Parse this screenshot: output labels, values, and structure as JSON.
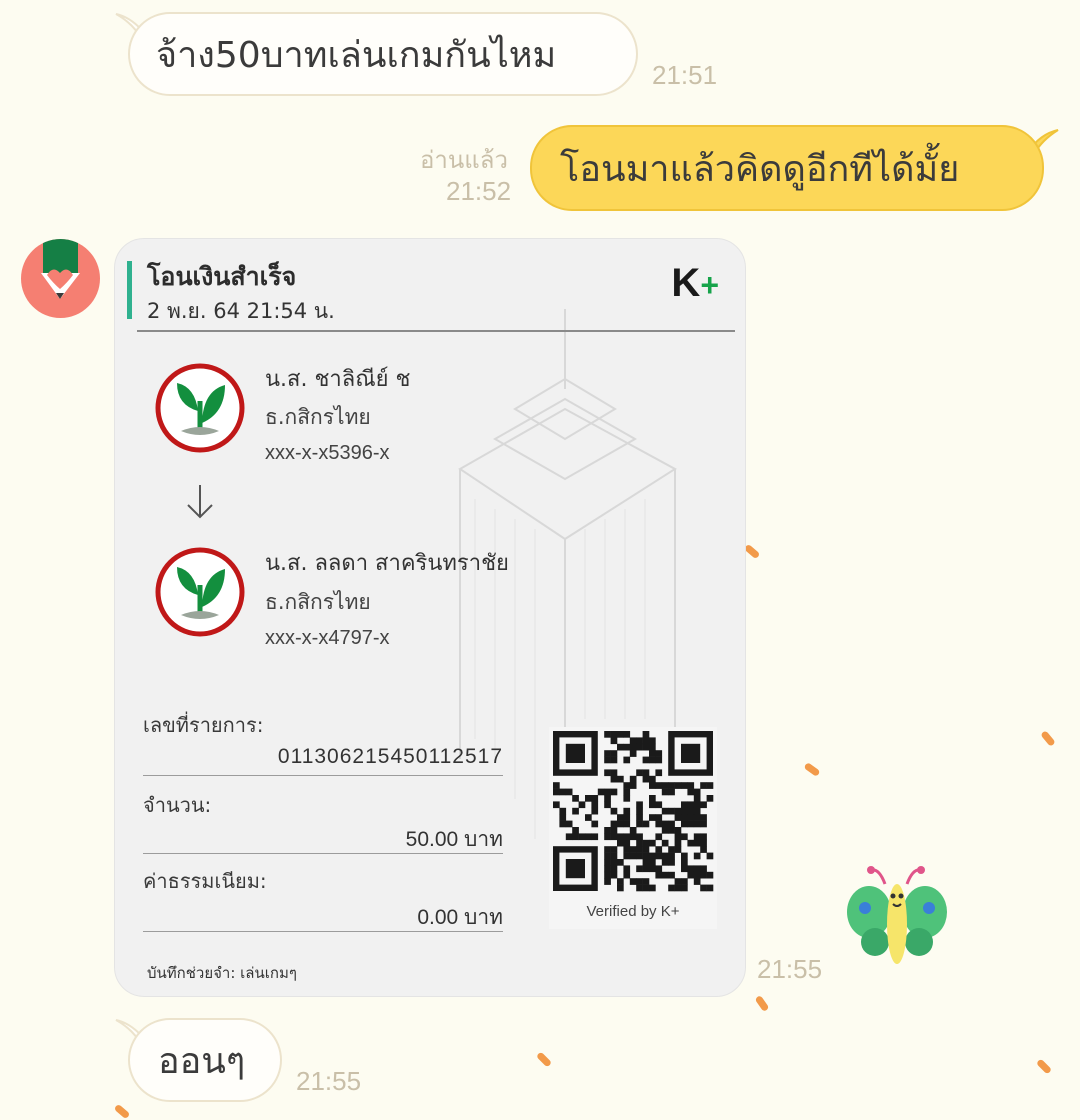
{
  "messages": [
    {
      "text": "จ้าง50บาทเล่นเกมกันไหม",
      "time": "21:51"
    },
    {
      "text": "โอนมาแล้วคิดดูอีกทีได้มั้ย",
      "time": "21:52",
      "read": "อ่านแล้ว"
    },
    {
      "time": "21:55"
    },
    {
      "text": "ออนๆ",
      "time": "21:55"
    }
  ],
  "slip": {
    "title": "โอนเงินสำเร็จ",
    "datetime": "2 พ.ย. 64  21:54 น.",
    "brand": "K+",
    "sender": {
      "name": "น.ส. ชาลิณีย์ ช",
      "bank": "ธ.กสิกรไทย",
      "account": "xxx-x-x5396-x"
    },
    "receiver": {
      "name": "น.ส. ลลดา สาครินทราชัย",
      "bank": "ธ.กสิกรไทย",
      "account": "xxx-x-x4797-x"
    },
    "ref_label": "เลขที่รายการ:",
    "ref_value": "011306215450112517",
    "amount_label": "จำนวน:",
    "amount_value": "50.00 บาท",
    "fee_label": "ค่าธรรมเนียม:",
    "fee_value": "0.00 บาท",
    "memo": "บันทึกช่วยจำ: เล่นเกมๆ",
    "verified": "Verified by K+"
  },
  "colors": {
    "background": "#fdfcf1",
    "outgoing_bubble": "#fcd758",
    "incoming_bubble": "#fffefa",
    "kbank_green": "#138f3e",
    "brand_accent": "#2fb18f"
  },
  "icons": {
    "avatar": "kbank-avatar-icon",
    "arrow": "arrow-down-icon",
    "sticker": "butterfly-sticker-icon"
  }
}
